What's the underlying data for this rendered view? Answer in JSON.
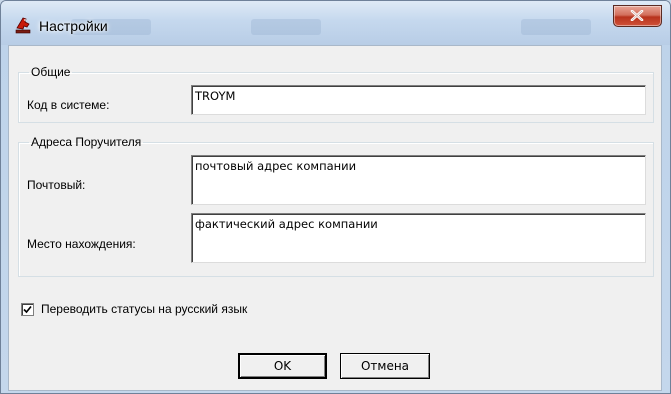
{
  "window": {
    "title": "Настройки",
    "icon": "chess-piece-icon",
    "close_icon": "close-icon"
  },
  "general": {
    "legend": "Общие",
    "code_label": "Код в системе:",
    "code_value": "TROYM"
  },
  "addresses": {
    "legend": "Адреса Поручителя",
    "postal_label": "Почтовый:",
    "postal_value": "почтовый адрес компании",
    "location_label": "Место нахождения:",
    "location_value": "фактический адрес компании"
  },
  "options": {
    "translate_label": "Переводить статусы на русский язык",
    "translate_checked": true
  },
  "buttons": {
    "ok": "OK",
    "cancel": "Отмена"
  },
  "colors": {
    "close_button": "#c8402a",
    "dialog_bg": "#f0f0f0"
  }
}
